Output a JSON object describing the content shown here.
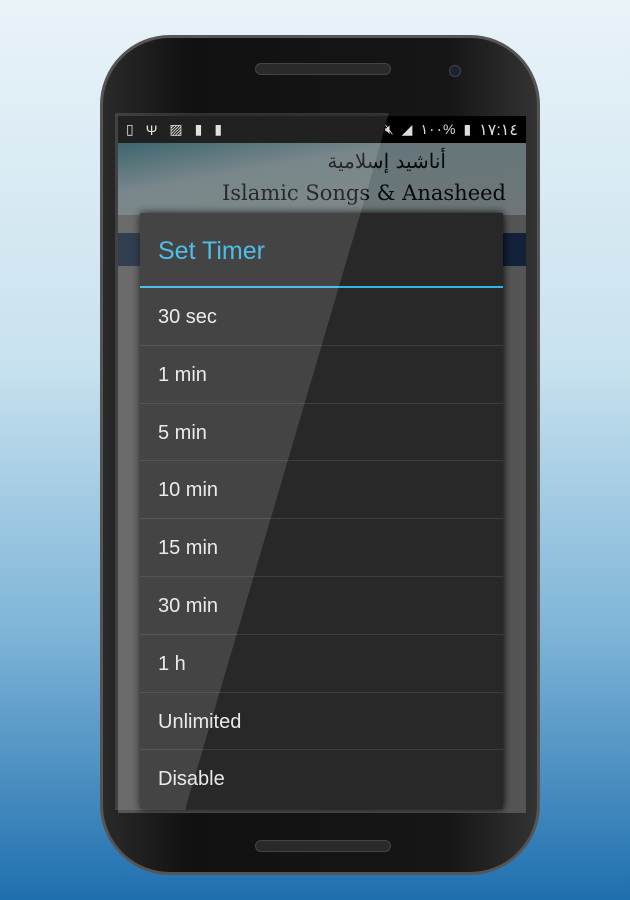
{
  "status_bar": {
    "left_icons": [
      "phone-check-icon",
      "usb-icon",
      "image-icon",
      "battery-recycle-icon",
      "battery-100-icon"
    ],
    "battery_percent": "١٠٠%",
    "time": "١٧:١٤"
  },
  "banner": {
    "arabic_title": "أناشيد إسلامية",
    "english_title": "Islamic Songs & Anasheed"
  },
  "dialog": {
    "title": "Set Timer",
    "options": [
      "30 sec",
      "1 min",
      "5 min",
      "10 min",
      "15 min",
      "30 min",
      "1 h",
      "Unlimited",
      "Disable"
    ]
  },
  "colors": {
    "accent": "#33b5e5",
    "dialog_bg": "#282828"
  }
}
